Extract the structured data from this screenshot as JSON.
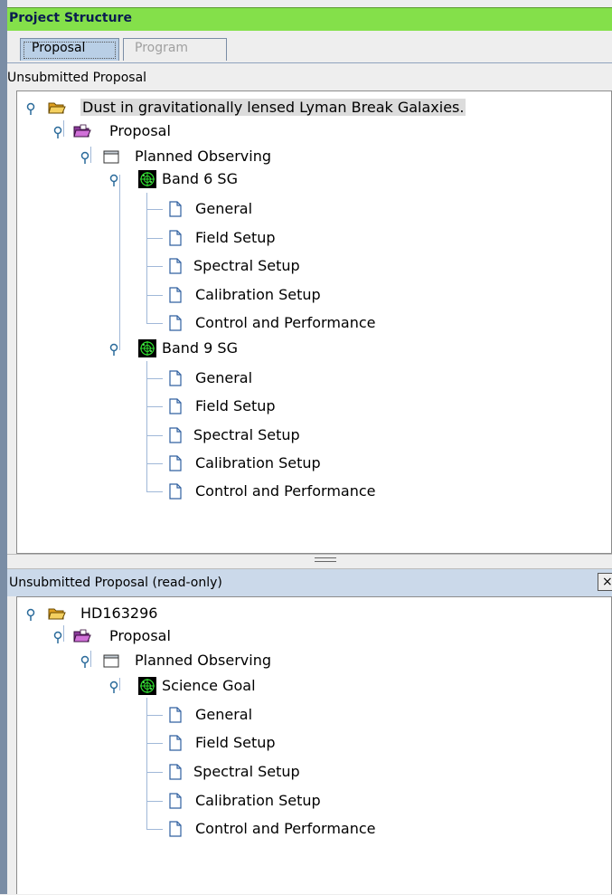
{
  "window": {
    "title": "Project Structure"
  },
  "tabs": [
    {
      "label": "Proposal",
      "active": true
    },
    {
      "label": "Program",
      "active": false
    }
  ],
  "top_panel": {
    "header": "Unsubmitted Proposal",
    "tree": {
      "root": "Dust in gravitationally lensed Lyman Break Galaxies.",
      "proposal": "Proposal",
      "planned": "Planned Observing",
      "goals": [
        {
          "name": "Band 6 SG",
          "items": [
            "General",
            "Field Setup",
            "Spectral Setup",
            "Calibration Setup",
            "Control and Performance"
          ]
        },
        {
          "name": "Band 9 SG",
          "items": [
            "General",
            "Field Setup",
            "Spectral Setup",
            "Calibration Setup",
            "Control and Performance"
          ]
        }
      ]
    }
  },
  "bottom_panel": {
    "header": "Unsubmitted Proposal  (read-only)",
    "close_label": "×",
    "tree": {
      "root": "HD163296",
      "proposal": "Proposal",
      "planned": "Planned Observing",
      "goal": {
        "name": "Science Goal",
        "items": [
          "General",
          "Field Setup",
          "Spectral Setup",
          "Calibration Setup",
          "Control and Performance"
        ]
      }
    }
  },
  "colors": {
    "title_bar": "#84e04a",
    "title_text": "#0b1c50",
    "active_tab": "#b9cfe6",
    "readonly_header": "#cbd9ea",
    "tree_line": "#a0b8d8"
  }
}
